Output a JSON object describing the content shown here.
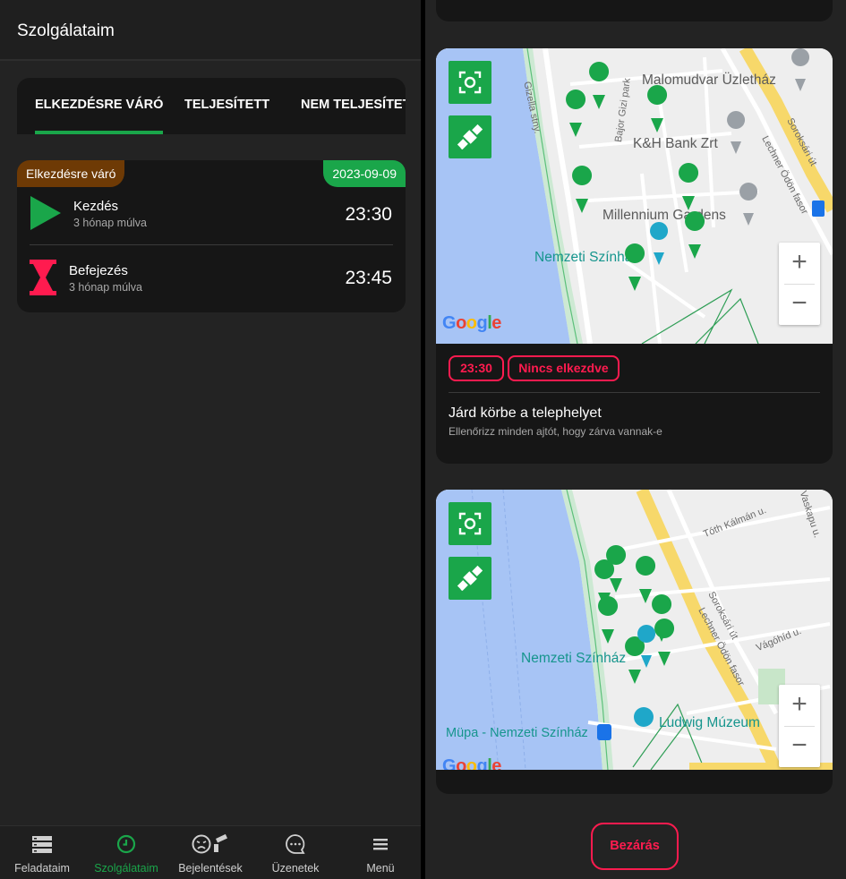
{
  "app": {
    "title": "Szolgálataim"
  },
  "tabs": [
    {
      "label": "ELKEZDÉSRE VÁRÓ",
      "active": true
    },
    {
      "label": "TELJESÍTETT",
      "active": false
    },
    {
      "label": "NEM TELJESÍTETT",
      "active": false
    }
  ],
  "duty": {
    "status": "Elkezdésre váró",
    "date": "2023-09-09",
    "start": {
      "label": "Kezdés",
      "relative": "3 hónap múlva",
      "time": "23:30"
    },
    "end": {
      "label": "Befejezés",
      "relative": "3 hónap múlva",
      "time": "23:45"
    }
  },
  "bottom_nav": [
    {
      "label": "Feladataim",
      "icon": "server-icon",
      "active": false
    },
    {
      "label": "Szolgálataim",
      "icon": "clock-icon",
      "active": true
    },
    {
      "label": "Bejelentések",
      "icon": "angry-face-camera-icon",
      "active": false
    },
    {
      "label": "Üzenetek",
      "icon": "chat-bubble-icon",
      "active": false
    },
    {
      "label": "Menü",
      "icon": "hamburger-icon",
      "active": false
    }
  ],
  "map1": {
    "labels": {
      "malomudvar": "Malomudvar Üzletház",
      "khbank": "K&H Bank Zrt",
      "millennium": "Millennium Gardens",
      "szinhaz": "Nemzeti Színház",
      "gizella": "Gizella stny.",
      "bajor": "Bajor Gizi park",
      "soroksari": "Soroksári út",
      "lechner": "Lechner Ödön fasor"
    },
    "google": "Google"
  },
  "task": {
    "time_chip": "23:30",
    "status_chip": "Nincs elkezdve",
    "title": "Járd körbe a telephelyet",
    "description": "Ellenőrizz minden ajtót, hogy zárva vannak-e"
  },
  "map2": {
    "labels": {
      "tothkalman": "Tóth Kálmán u.",
      "vaskapu": "Vaskapu u.",
      "soroksari": "Soroksári út",
      "lechner": "Lechner Ödön fasor",
      "vagohid": "Vágóhíd u.",
      "szinhaz": "Nemzeti Színház",
      "ludwig": "Ludwig Múzeum",
      "mupa": "Müpa - Nemzeti Színház"
    },
    "google": "Google"
  },
  "close_button": "Bezárás",
  "colors": {
    "accent_green": "#1aa64a",
    "danger": "#ff1b4f",
    "status_brown": "#6e3a05"
  }
}
